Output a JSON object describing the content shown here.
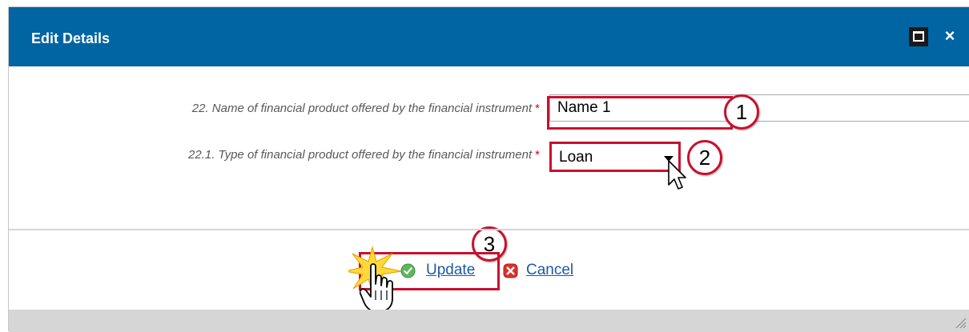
{
  "dialog": {
    "title": "Edit Details",
    "maximize_icon": "maximize-icon",
    "close_label": "×"
  },
  "fields": [
    {
      "label": "22. Name of financial product offered by the financial instrument",
      "required_mark": "*",
      "value": "Name 1"
    },
    {
      "label": "22.1. Type of financial product offered by the financial instrument",
      "required_mark": "*",
      "selected": "Loan"
    }
  ],
  "steps": [
    "1",
    "2",
    "3"
  ],
  "actions": {
    "update_label": "Update",
    "cancel_label": "Cancel"
  },
  "colors": {
    "titlebar": "#0065a2",
    "highlight": "#c8102e",
    "link": "#1a5aa6",
    "required": "#d0021b"
  }
}
